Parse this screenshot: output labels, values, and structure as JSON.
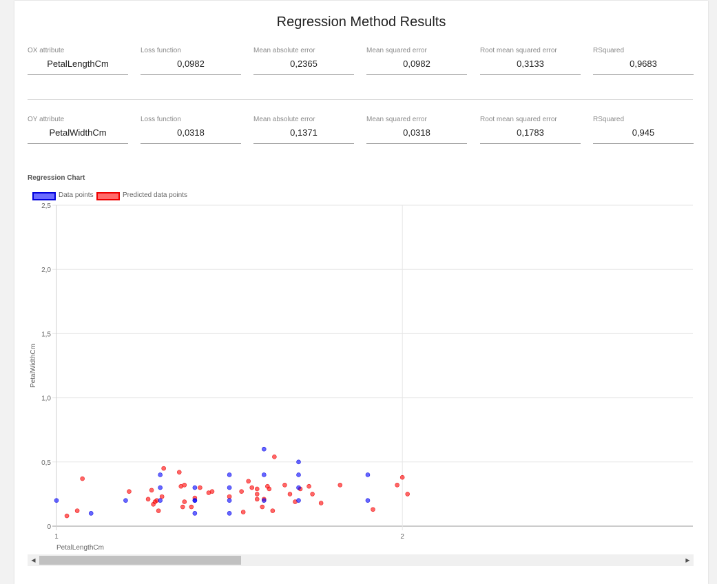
{
  "title": "Regression Method Results",
  "ox_row": [
    {
      "label": "OX attribute",
      "value": "PetalLengthCm"
    },
    {
      "label": "Loss function",
      "value": "0,0982"
    },
    {
      "label": "Mean absolute error",
      "value": "0,2365"
    },
    {
      "label": "Mean squared error",
      "value": "0,0982"
    },
    {
      "label": "Root mean squared error",
      "value": "0,3133"
    },
    {
      "label": "RSquared",
      "value": "0,9683"
    }
  ],
  "oy_row": [
    {
      "label": "OY attribute",
      "value": "PetalWidthCm"
    },
    {
      "label": "Loss function",
      "value": "0,0318"
    },
    {
      "label": "Mean absolute error",
      "value": "0,1371"
    },
    {
      "label": "Mean squared error",
      "value": "0,0318"
    },
    {
      "label": "Root mean squared error",
      "value": "0,1783"
    },
    {
      "label": "RSquared",
      "value": "0,945"
    }
  ],
  "chart": {
    "title": "Regression Chart",
    "legend": [
      {
        "label": "Data points",
        "fill": "#6b6bff",
        "border": "#0000dd"
      },
      {
        "label": "Predicted data points",
        "fill": "#ff6b6b",
        "border": "#ee0000"
      }
    ]
  },
  "chart_data": {
    "type": "scatter",
    "xlabel": "PetalLengthCm",
    "ylabel": "PetalWidthCm",
    "x_ticks": [
      "1",
      "2"
    ],
    "y_ticks": [
      "0",
      "0,5",
      "1,0",
      "1,5",
      "2,0",
      "2,5"
    ],
    "xlim": [
      1,
      2.84
    ],
    "ylim": [
      0,
      2.5
    ],
    "grid": true,
    "legend_position": "top-left",
    "series": [
      {
        "name": "Data points",
        "color": "#0000ff",
        "points": [
          [
            1.0,
            0.2
          ],
          [
            1.1,
            0.1
          ],
          [
            1.2,
            0.2
          ],
          [
            1.3,
            0.2
          ],
          [
            1.3,
            0.3
          ],
          [
            1.3,
            0.4
          ],
          [
            1.4,
            0.1
          ],
          [
            1.4,
            0.2
          ],
          [
            1.4,
            0.2
          ],
          [
            1.4,
            0.3
          ],
          [
            1.5,
            0.1
          ],
          [
            1.5,
            0.2
          ],
          [
            1.5,
            0.3
          ],
          [
            1.5,
            0.4
          ],
          [
            1.6,
            0.2
          ],
          [
            1.6,
            0.4
          ],
          [
            1.6,
            0.6
          ],
          [
            1.7,
            0.2
          ],
          [
            1.7,
            0.3
          ],
          [
            1.7,
            0.4
          ],
          [
            1.7,
            0.5
          ],
          [
            1.9,
            0.2
          ],
          [
            1.9,
            0.4
          ]
        ]
      },
      {
        "name": "Predicted data points",
        "color": "#ff0000",
        "points": [
          [
            1.03,
            0.08
          ],
          [
            1.06,
            0.12
          ],
          [
            1.075,
            0.37
          ],
          [
            1.21,
            0.27
          ],
          [
            1.265,
            0.21
          ],
          [
            1.275,
            0.28
          ],
          [
            1.28,
            0.17
          ],
          [
            1.285,
            0.19
          ],
          [
            1.29,
            0.2
          ],
          [
            1.295,
            0.12
          ],
          [
            1.305,
            0.23
          ],
          [
            1.31,
            0.45
          ],
          [
            1.355,
            0.42
          ],
          [
            1.36,
            0.31
          ],
          [
            1.365,
            0.15
          ],
          [
            1.37,
            0.19
          ],
          [
            1.37,
            0.32
          ],
          [
            1.39,
            0.15
          ],
          [
            1.4,
            0.22
          ],
          [
            1.415,
            0.3
          ],
          [
            1.44,
            0.26
          ],
          [
            1.45,
            0.27
          ],
          [
            1.5,
            0.23
          ],
          [
            1.535,
            0.27
          ],
          [
            1.54,
            0.11
          ],
          [
            1.555,
            0.35
          ],
          [
            1.565,
            0.3
          ],
          [
            1.58,
            0.21
          ],
          [
            1.58,
            0.25
          ],
          [
            1.58,
            0.29
          ],
          [
            1.595,
            0.15
          ],
          [
            1.6,
            0.21
          ],
          [
            1.61,
            0.31
          ],
          [
            1.615,
            0.29
          ],
          [
            1.625,
            0.12
          ],
          [
            1.63,
            0.54
          ],
          [
            1.66,
            0.32
          ],
          [
            1.675,
            0.25
          ],
          [
            1.69,
            0.19
          ],
          [
            1.705,
            0.29
          ],
          [
            1.73,
            0.31
          ],
          [
            1.74,
            0.25
          ],
          [
            1.765,
            0.18
          ],
          [
            1.82,
            0.32
          ],
          [
            1.915,
            0.13
          ],
          [
            1.985,
            0.32
          ],
          [
            2.0,
            0.38
          ],
          [
            2.015,
            0.25
          ]
        ]
      }
    ]
  }
}
